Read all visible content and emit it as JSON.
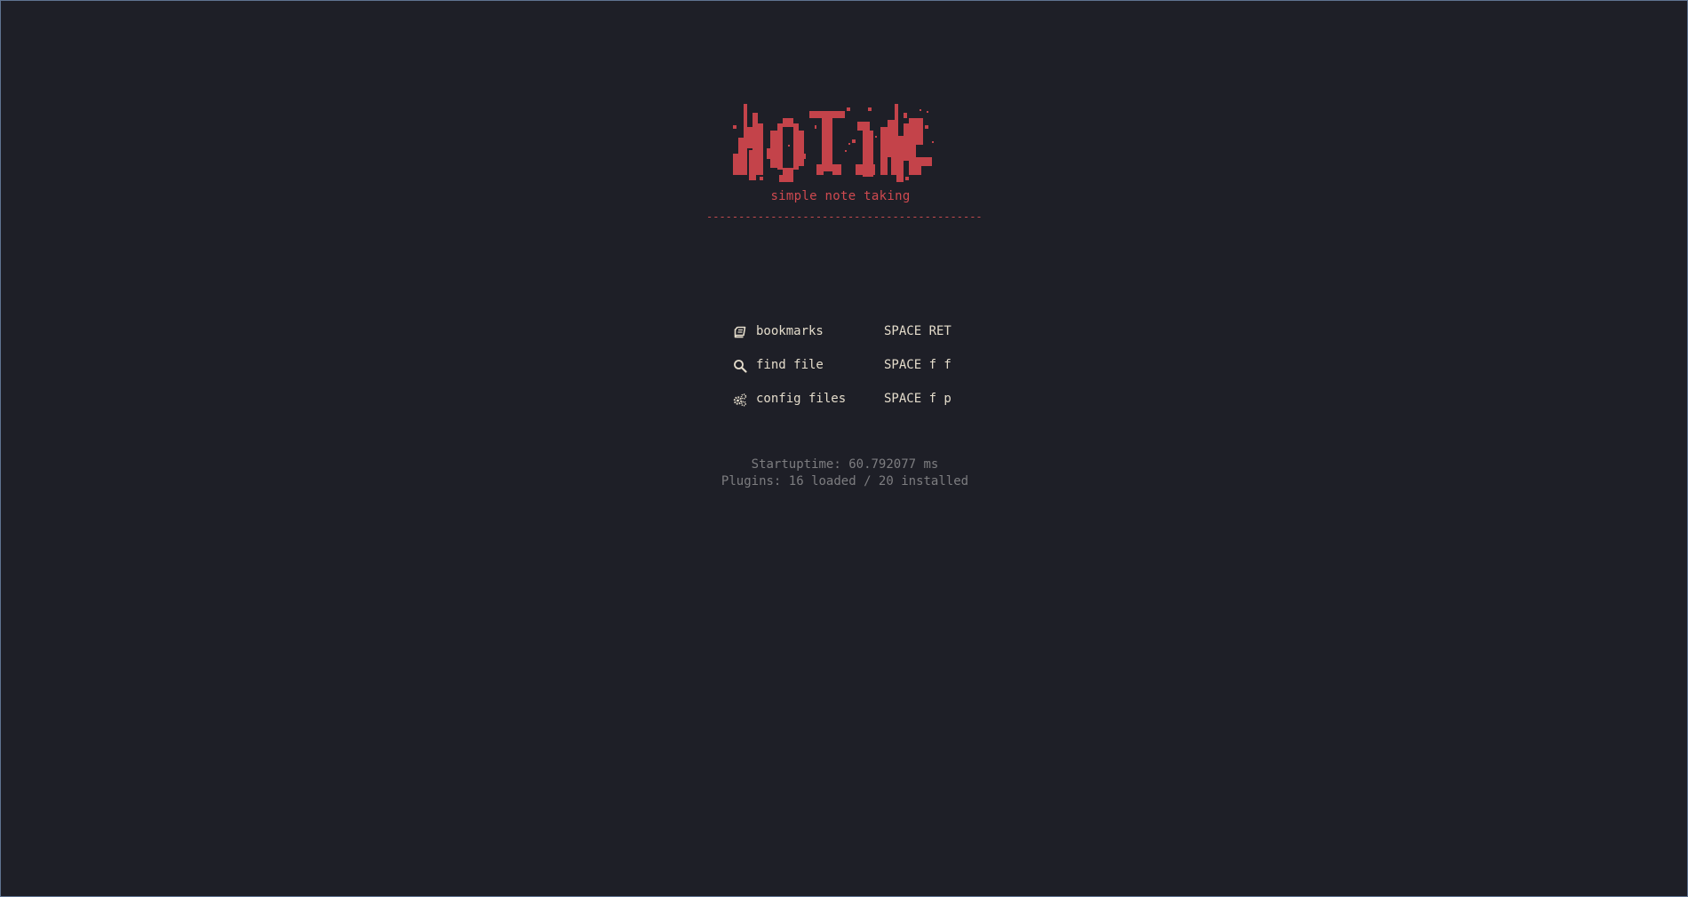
{
  "header": {
    "tagline": "simple note taking",
    "divider": "----------------------------------------------"
  },
  "menu": {
    "items": [
      {
        "icon": "book-icon",
        "label": "bookmarks",
        "shortcut": "SPACE RET"
      },
      {
        "icon": "search-icon",
        "label": "find file",
        "shortcut": "SPACE f f"
      },
      {
        "icon": "gears-icon",
        "label": "config files",
        "shortcut": "SPACE f p"
      }
    ]
  },
  "footer": {
    "startuptime": "Startuptime: 60.792077 ms",
    "plugins": "Plugins: 16 loaded / 20 installed"
  },
  "colors": {
    "background": "#1e1f27",
    "accent": "#c9444b",
    "text": "#e4dccb",
    "muted": "#7d7d80"
  }
}
